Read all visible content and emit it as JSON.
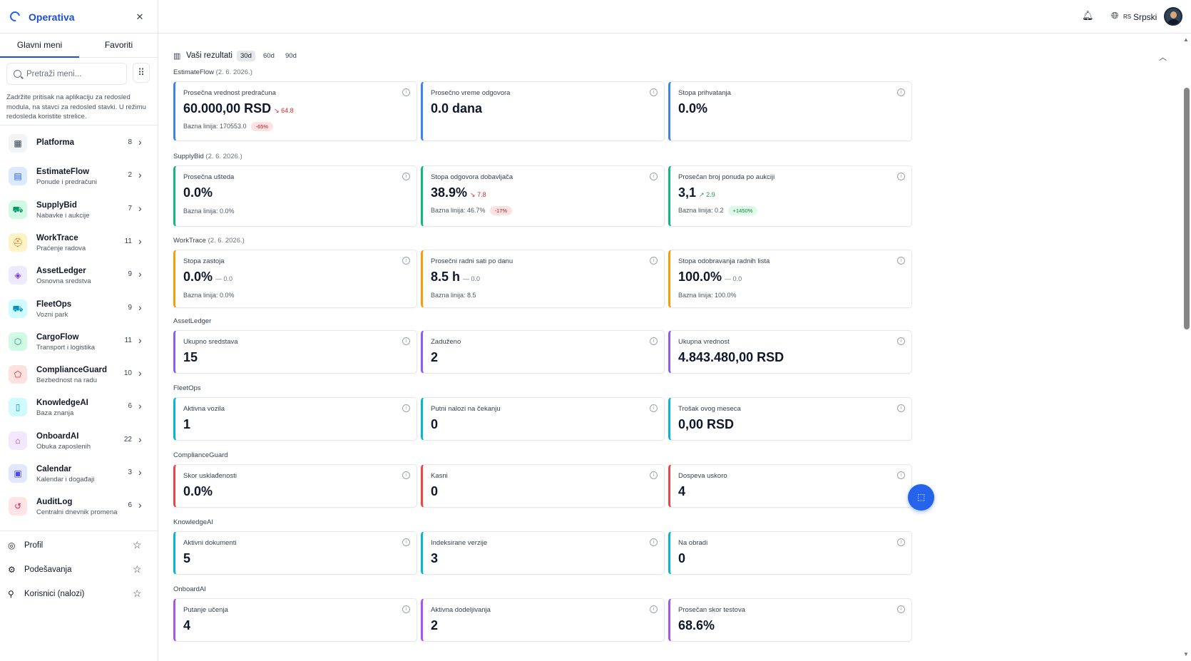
{
  "app": {
    "name": "Operativa"
  },
  "sidebar": {
    "tabs": [
      "Glavni meni",
      "Favoriti"
    ],
    "search_placeholder": "Pretraži meni...",
    "hint": "Zadržite pritisak na aplikaciju za redosled modula, na stavci za redosled stavki. U režimu redosleda koristite strelice.",
    "items": [
      {
        "title": "Platforma",
        "subtitle": "",
        "count": "8",
        "icon": "grid-icon",
        "color": "#374151",
        "bg": "#f3f4f6"
      },
      {
        "title": "EstimateFlow",
        "subtitle": "Ponude i predračuni",
        "count": "2",
        "icon": "document-icon",
        "color": "#2563eb",
        "bg": "#dbeafe"
      },
      {
        "title": "SupplyBid",
        "subtitle": "Nabavke i aukcije",
        "count": "7",
        "icon": "cart-icon",
        "color": "#059669",
        "bg": "#d1fae5"
      },
      {
        "title": "WorkTrace",
        "subtitle": "Praćenje radova",
        "count": "11",
        "icon": "hardhat-icon",
        "color": "#d97706",
        "bg": "#fef3c7"
      },
      {
        "title": "AssetLedger",
        "subtitle": "Osnovna sredstva",
        "count": "9",
        "icon": "box-icon",
        "color": "#7c3aed",
        "bg": "#ede9fe"
      },
      {
        "title": "FleetOps",
        "subtitle": "Vozni park",
        "count": "9",
        "icon": "truck-icon",
        "color": "#0891b2",
        "bg": "#cffafe"
      },
      {
        "title": "CargoFlow",
        "subtitle": "Transport i logistika",
        "count": "11",
        "icon": "package-icon",
        "color": "#059669",
        "bg": "#d1fae5"
      },
      {
        "title": "ComplianceGuard",
        "subtitle": "Bezbednost na radu",
        "count": "10",
        "icon": "shield-icon",
        "color": "#dc2626",
        "bg": "#fee2e2"
      },
      {
        "title": "KnowledgeAI",
        "subtitle": "Baza znanja",
        "count": "6",
        "icon": "book-icon",
        "color": "#0891b2",
        "bg": "#cffafe"
      },
      {
        "title": "OnboardAI",
        "subtitle": "Obuka zaposlenih",
        "count": "22",
        "icon": "graduation-cap-icon",
        "color": "#9333ea",
        "bg": "#f3e8ff"
      },
      {
        "title": "Calendar",
        "subtitle": "Kalendar i događaji",
        "count": "3",
        "icon": "calendar-icon",
        "color": "#4f46e5",
        "bg": "#e0e7ff"
      },
      {
        "title": "AuditLog",
        "subtitle": "Centralni dnevnik promena",
        "count": "6",
        "icon": "history-icon",
        "color": "#e11d48",
        "bg": "#ffe4e6"
      }
    ],
    "footer": [
      {
        "label": "Profil",
        "icon": "user-circle-icon"
      },
      {
        "label": "Podešavanja",
        "icon": "gear-icon"
      },
      {
        "label": "Korisnici (nalozi)",
        "icon": "users-icon"
      }
    ]
  },
  "topbar": {
    "lang_code": "RS",
    "lang": "Srpski"
  },
  "results": {
    "title": "Vaši rezultati",
    "ranges": [
      "30d",
      "60d",
      "90d"
    ],
    "active_range": "30d"
  },
  "sections": [
    {
      "name": "EstimateFlow",
      "date": "(2. 6. 2026.)",
      "color": "#3b82f6",
      "cards": [
        {
          "label": "Prosečna vrednost predračuna",
          "value": "60.000,00 RSD",
          "delta": "64.8",
          "delta_dir": "down",
          "baseline": "Bazna linija: 170553.0",
          "badge": "-65%",
          "badge_type": "neg"
        },
        {
          "label": "Prosečno vreme odgovora",
          "value": "0.0 dana"
        },
        {
          "label": "Stopa prihvatanja",
          "value": "0.0%"
        }
      ]
    },
    {
      "name": "SupplyBid",
      "date": "(2. 6. 2026.)",
      "color": "#10b981",
      "cards": [
        {
          "label": "Prosečna ušteda",
          "value": "0.0%",
          "baseline": "Bazna linija: 0.0%"
        },
        {
          "label": "Stopa odgovora dobavljača",
          "value": "38.9%",
          "delta": "7.8",
          "delta_dir": "down",
          "baseline": "Bazna linija: 46.7%",
          "badge": "-17%",
          "badge_type": "neg"
        },
        {
          "label": "Prosečan broj ponuda po aukciji",
          "value": "3,1",
          "delta": "2.9",
          "delta_dir": "up",
          "baseline": "Bazna linija: 0.2",
          "badge": "+1450%",
          "badge_type": "pos"
        }
      ]
    },
    {
      "name": "WorkTrace",
      "date": "(2. 6. 2026.)",
      "color": "#f59e0b",
      "cards": [
        {
          "label": "Stopa zastoja",
          "value": "0.0%",
          "delta": "0.0",
          "delta_dir": "flat",
          "baseline": "Bazna linija: 0.0%"
        },
        {
          "label": "Prosečni radni sati po danu",
          "value": "8.5 h",
          "delta": "0.0",
          "delta_dir": "flat",
          "baseline": "Bazna linija: 8.5"
        },
        {
          "label": "Stopa odobravanja radnih lista",
          "value": "100.0%",
          "delta": "0.0",
          "delta_dir": "flat",
          "baseline": "Bazna linija: 100.0%"
        }
      ]
    },
    {
      "name": "AssetLedger",
      "date": "",
      "color": "#8b5cf6",
      "cards": [
        {
          "label": "Ukupno sredstava",
          "value": "15"
        },
        {
          "label": "Zaduženo",
          "value": "2"
        },
        {
          "label": "Ukupna vrednost",
          "value": "4.843.480,00 RSD"
        }
      ]
    },
    {
      "name": "FleetOps",
      "date": "",
      "color": "#06b6d4",
      "cards": [
        {
          "label": "Aktivna vozila",
          "value": "1"
        },
        {
          "label": "Putni nalozi na čekanju",
          "value": "0"
        },
        {
          "label": "Trošak ovog meseca",
          "value": "0,00 RSD"
        }
      ]
    },
    {
      "name": "ComplianceGuard",
      "date": "",
      "color": "#ef4444",
      "cards": [
        {
          "label": "Skor usklađenosti",
          "value": "0.0%"
        },
        {
          "label": "Kasni",
          "value": "0"
        },
        {
          "label": "Dospeva uskoro",
          "value": "4"
        }
      ]
    },
    {
      "name": "KnowledgeAI",
      "date": "",
      "color": "#06b6d4",
      "cards": [
        {
          "label": "Aktivni dokumenti",
          "value": "5"
        },
        {
          "label": "Indeksirane verzije",
          "value": "3"
        },
        {
          "label": "Na obradi",
          "value": "0"
        }
      ]
    },
    {
      "name": "OnboardAI",
      "date": "",
      "color": "#a855f7",
      "cards": [
        {
          "label": "Putanje učenja",
          "value": "4"
        },
        {
          "label": "Aktivna dodeljivanja",
          "value": "2"
        },
        {
          "label": "Prosečan skor testova",
          "value": "68.6%"
        }
      ]
    }
  ]
}
